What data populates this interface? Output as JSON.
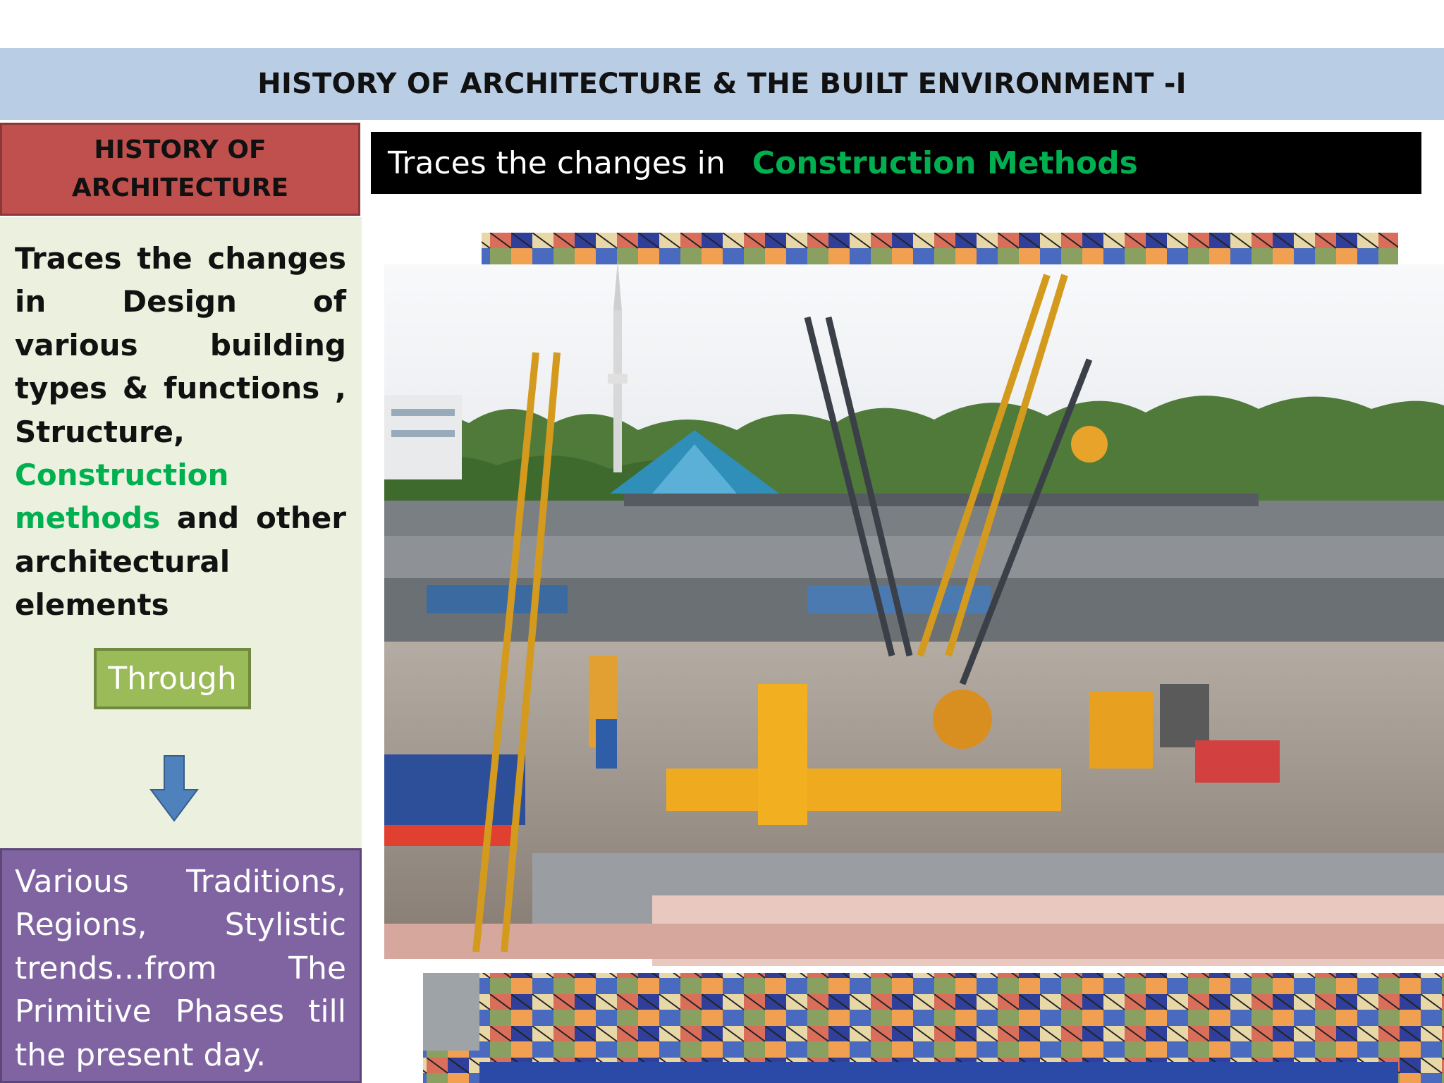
{
  "header": {
    "title": "HISTORY OF ARCHITECTURE & THE BUILT ENVIRONMENT -I"
  },
  "left": {
    "heading": "HISTORY OF\nARCHITECTURE",
    "body_prefix": "Traces the changes in Design of various building types & functions , Structure, ",
    "body_highlight": "Construction methods",
    "body_suffix": " and other architectural elements",
    "through_label": "Through",
    "traditions_text": "Various Traditions, Regions, Stylistic trends…from The Primitive Phases till the present day."
  },
  "right": {
    "banner_text": "Traces the changes in",
    "banner_highlight": "Construction Methods"
  },
  "colors": {
    "title_bar": "#b9cde5",
    "heading_box": "#c0504d",
    "left_panel": "#ebf1de",
    "through_button": "#9bbb59",
    "purple_box": "#8064a2",
    "highlight_green": "#00b050",
    "arrow_blue": "#4f81bd"
  },
  "icons": {
    "arrow": "down-arrow-icon"
  }
}
